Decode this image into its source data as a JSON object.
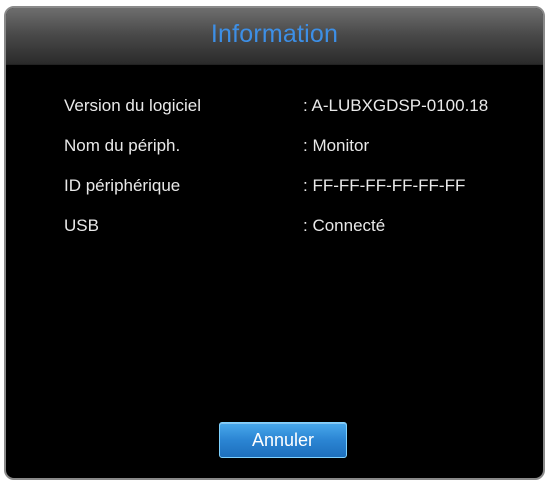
{
  "dialog": {
    "title": "Information",
    "rows": [
      {
        "label": "Version du logiciel",
        "value": ": A-LUBXGDSP-0100.18"
      },
      {
        "label": "Nom du périph.",
        "value": ": Monitor"
      },
      {
        "label": "ID périphérique",
        "value": ": FF-FF-FF-FF-FF-FF"
      },
      {
        "label": "USB",
        "value": ": Connecté"
      }
    ],
    "cancel_label": "Annuler"
  },
  "colors": {
    "title_text": "#3d8fe6",
    "background": "#000000",
    "button": "#2b85d3"
  }
}
